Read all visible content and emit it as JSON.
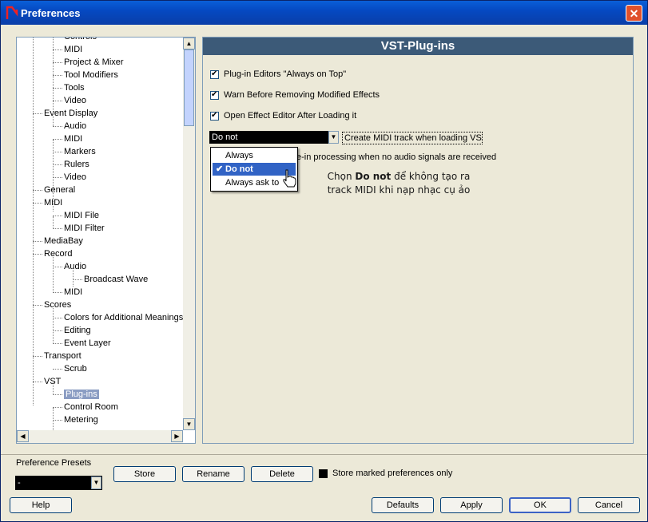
{
  "window": {
    "title": "Preferences",
    "close_glyph": "✕"
  },
  "tree": {
    "items": [
      {
        "label": "Controls",
        "level": 2
      },
      {
        "label": "MIDI",
        "level": 2
      },
      {
        "label": "Project & Mixer",
        "level": 2
      },
      {
        "label": "Tool Modifiers",
        "level": 2
      },
      {
        "label": "Tools",
        "level": 2
      },
      {
        "label": "Video",
        "level": 2
      },
      {
        "label": "Event Display",
        "level": 1
      },
      {
        "label": "Audio",
        "level": 2
      },
      {
        "label": "MIDI",
        "level": 2
      },
      {
        "label": "Markers",
        "level": 2
      },
      {
        "label": "Rulers",
        "level": 2
      },
      {
        "label": "Video",
        "level": 2
      },
      {
        "label": "General",
        "level": 1
      },
      {
        "label": "MIDI",
        "level": 1
      },
      {
        "label": "MIDI File",
        "level": 2
      },
      {
        "label": "MIDI Filter",
        "level": 2
      },
      {
        "label": "MediaBay",
        "level": 1
      },
      {
        "label": "Record",
        "level": 1
      },
      {
        "label": "Audio",
        "level": 2
      },
      {
        "label": "Broadcast Wave",
        "level": 3
      },
      {
        "label": "MIDI",
        "level": 2
      },
      {
        "label": "Scores",
        "level": 1
      },
      {
        "label": "Colors for Additional Meanings",
        "level": 2
      },
      {
        "label": "Editing",
        "level": 2
      },
      {
        "label": "Event Layer",
        "level": 2
      },
      {
        "label": "Transport",
        "level": 1
      },
      {
        "label": "Scrub",
        "level": 2
      },
      {
        "label": "VST",
        "level": 1
      },
      {
        "label": "Plug-ins",
        "level": 2,
        "selected": true
      },
      {
        "label": "Control Room",
        "level": 2
      },
      {
        "label": "Metering",
        "level": 2
      }
    ]
  },
  "panel": {
    "header": "VST-Plug-ins",
    "options": [
      {
        "label": "Plug-in Editors \"Always on Top\"",
        "checked": true
      },
      {
        "label": "Warn Before Removing Modified Effects",
        "checked": true
      },
      {
        "label": "Open Effect Editor After Loading it",
        "checked": true
      }
    ],
    "midi_select_value": "Do not",
    "midi_label": "Create MIDI track when loading VSTi",
    "partial_option": "e-in processing when no audio signals are received"
  },
  "dropdown": {
    "options": [
      "Always",
      "Do not",
      "Always ask to"
    ],
    "selected": "Do not",
    "tick": "✔"
  },
  "annotation": {
    "prefix": "Chọn ",
    "bold": "Do not",
    "suffix": " để không tạo ra",
    "line2": "track MIDI khi nạp nhạc cụ ảo"
  },
  "presets": {
    "label": "Preference Presets",
    "value": "-",
    "store": "Store",
    "rename": "Rename",
    "delete": "Delete",
    "store_only": "Store marked preferences only"
  },
  "footer": {
    "help": "Help",
    "defaults": "Defaults",
    "apply": "Apply",
    "ok": "OK",
    "cancel": "Cancel"
  },
  "colors": {
    "header_bg": "#3c5a78",
    "selection": "#3163c5",
    "tree_selection": "#8b9dc3"
  }
}
